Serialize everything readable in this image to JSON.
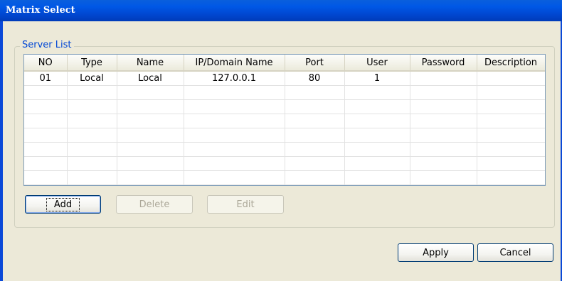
{
  "window": {
    "title": "Matrix Select"
  },
  "server_list": {
    "group_label": "Server List",
    "columns": [
      "NO",
      "Type",
      "Name",
      "IP/Domain Name",
      "Port",
      "User",
      "Password",
      "Description"
    ],
    "rows": [
      [
        "01",
        "Local",
        "Local",
        "127.0.0.1",
        "80",
        "1",
        "",
        ""
      ]
    ]
  },
  "buttons": {
    "add": "Add",
    "delete": "Delete",
    "edit": "Edit",
    "apply": "Apply",
    "cancel": "Cancel"
  },
  "colors": {
    "titlebar": "#0058e6",
    "dialog_background": "#ece9d8",
    "group_label": "#0046d5"
  }
}
